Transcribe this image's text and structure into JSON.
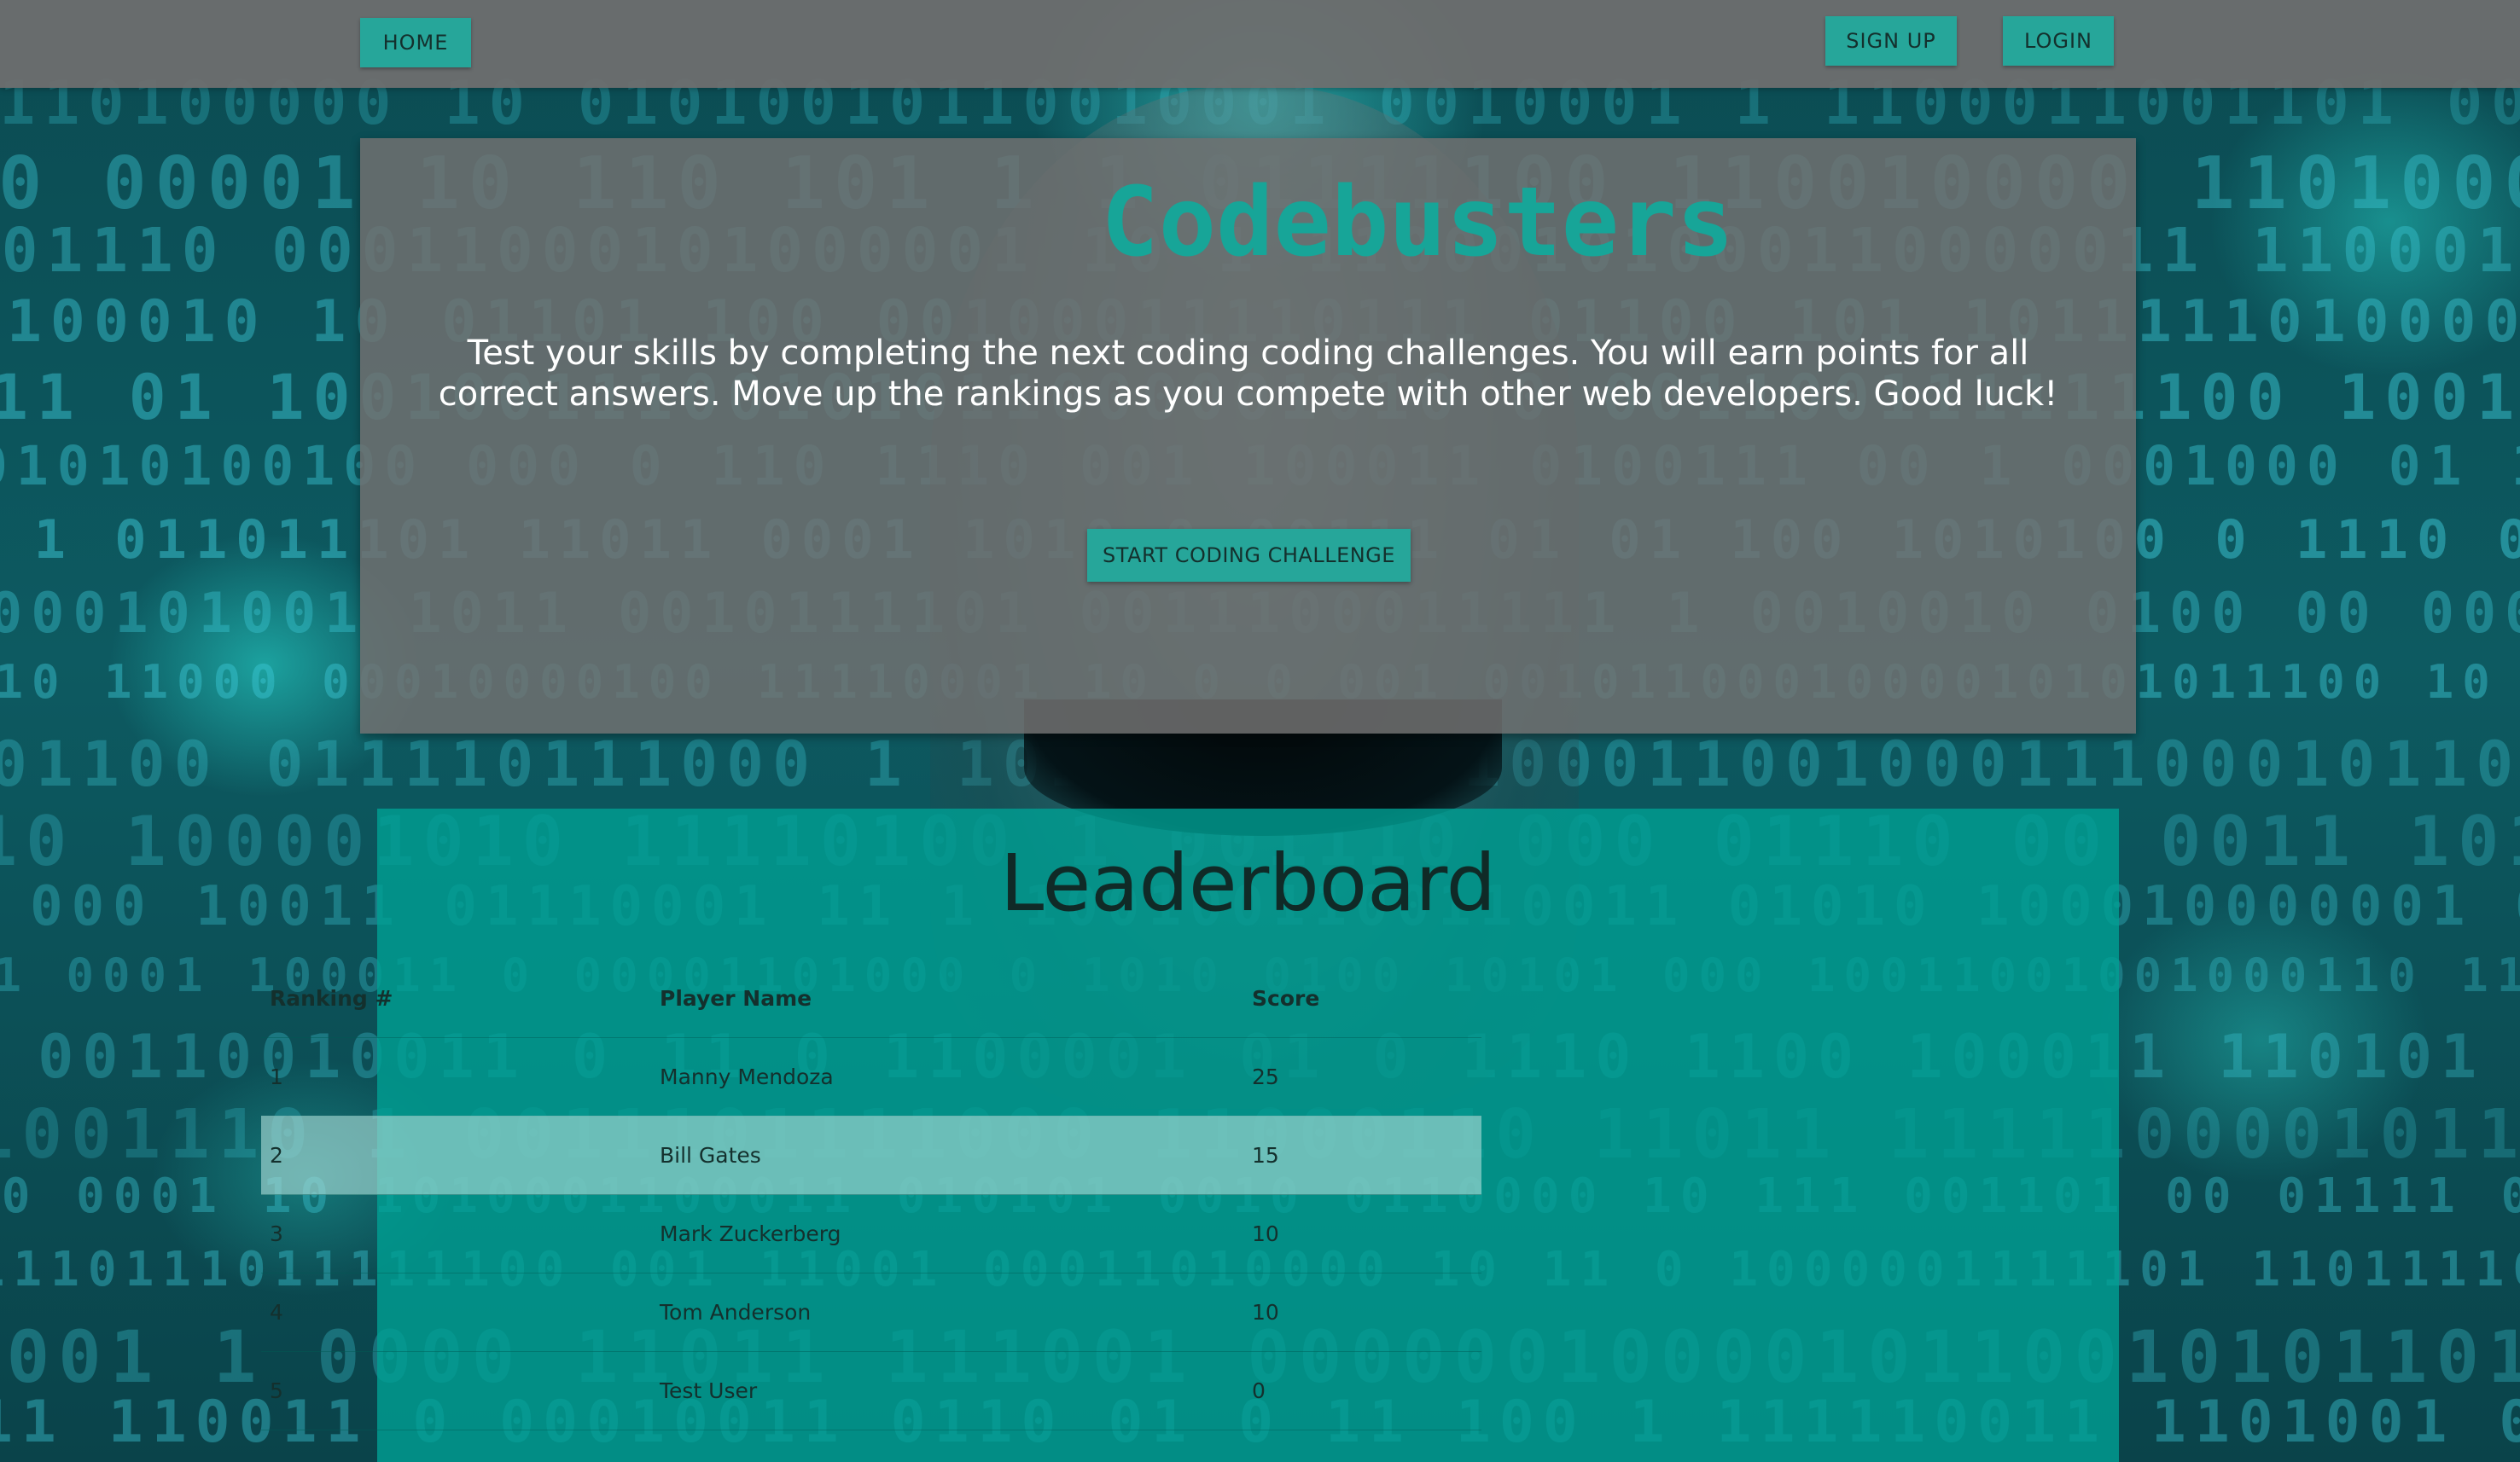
{
  "navbar": {
    "home_label": "HOME",
    "signup_label": "SIGN UP",
    "login_label": "LOGIN"
  },
  "hero": {
    "title": "Codebusters",
    "description": "Test your skills by completing the next coding coding challenges. You will earn points for all correct answers. Move up the rankings as you compete with other web developers. Good luck!",
    "start_button_label": "START CODING CHALLENGE"
  },
  "leaderboard": {
    "title": "Leaderboard",
    "columns": [
      "Ranking #",
      "Player Name",
      "Score"
    ],
    "rows": [
      {
        "rank": "1",
        "name": "Manny Mendoza",
        "score": "25"
      },
      {
        "rank": "2",
        "name": "Bill Gates",
        "score": "15"
      },
      {
        "rank": "3",
        "name": "Mark Zuckerberg",
        "score": "10"
      },
      {
        "rank": "4",
        "name": "Tom Anderson",
        "score": "10"
      },
      {
        "rank": "5",
        "name": "Test User",
        "score": "0"
      }
    ],
    "highlighted_row_index": 1
  },
  "colors": {
    "accent": "#26a69a",
    "title_accent": "#17a598",
    "navbar_bg": "#6e6e6e",
    "hero_bg": "#707070",
    "board_bg": "#00a094",
    "highlight_row": "#a5d7d2"
  }
}
